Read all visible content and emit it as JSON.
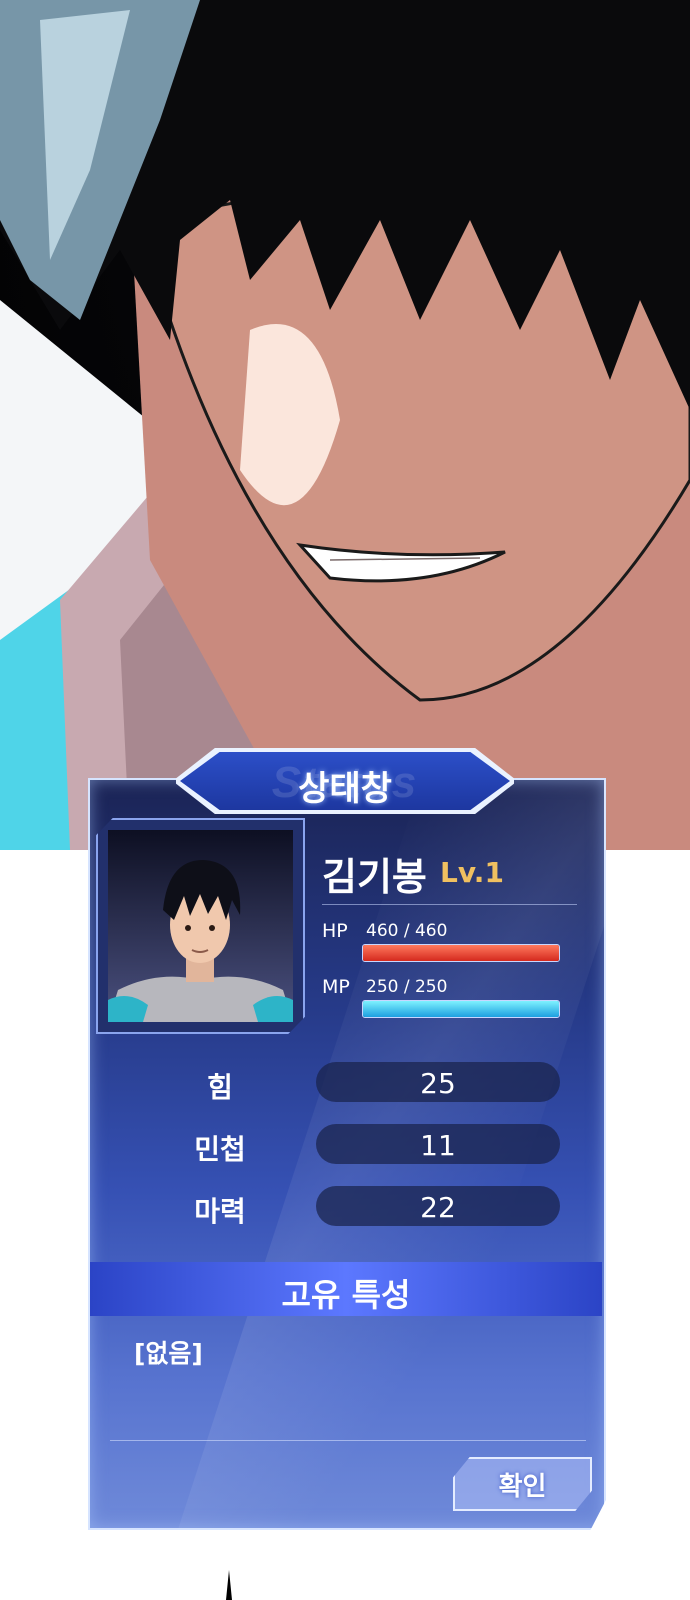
{
  "status_window": {
    "title": "상태창",
    "ghost_text": "Status",
    "character": {
      "name": "김기봉",
      "level": "Lv.1",
      "hp": {
        "label": "HP",
        "value": "460 / 460",
        "fraction": 1.0
      },
      "mp": {
        "label": "MP",
        "value": "250 / 250",
        "fraction": 1.0
      }
    },
    "stats": [
      {
        "name": "힘",
        "value": "25"
      },
      {
        "name": "민첩",
        "value": "11"
      },
      {
        "name": "마력",
        "value": "22"
      }
    ],
    "traits": {
      "title": "고유 특성",
      "items": [
        "[없음]"
      ]
    },
    "confirm_label": "확인"
  },
  "colors": {
    "window_top": "#1b2455",
    "window_bottom": "#6f8ad9",
    "level": "#f0c060",
    "hp_bar": "#d42a1e",
    "mp_bar": "#1d9fe0"
  }
}
